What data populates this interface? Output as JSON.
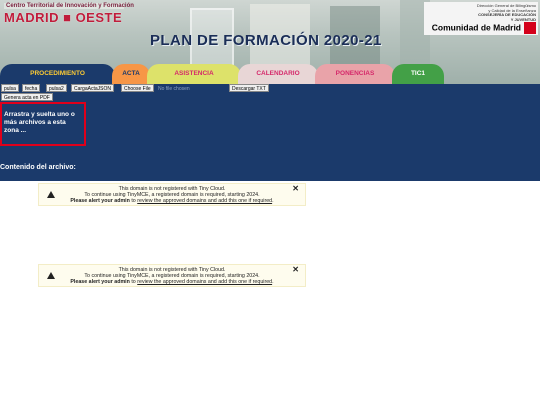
{
  "header": {
    "logo_left_small": "Centro Territorial de Innovación y Formación",
    "logo_left_big": "MADRID ■ OESTE",
    "logo_right_small1": "Dirección General de Bilingüismo",
    "logo_right_small2": "y Calidad de la Enseñanza",
    "logo_right_small3": "CONSEJERÍA DE EDUCACIÓN",
    "logo_right_small4": "Y JUVENTUD",
    "logo_right_big": "Comunidad de Madrid",
    "title": "PLAN DE FORMACIÓN 2020-21"
  },
  "tabs": [
    {
      "label": "PROCEDIMIENTO",
      "color": "#1b3a6b",
      "text": "#ffcc33"
    },
    {
      "label": "ACTA",
      "color": "#f79646",
      "text": "#1b3a6b"
    },
    {
      "label": "ASISTENCIA",
      "color": "#dde26a",
      "text": "#d5296a"
    },
    {
      "label": "CALENDARIO",
      "color": "#e8d6d6",
      "text": "#d5296a"
    },
    {
      "label": "PONENCIAS",
      "color": "#e9a3a9",
      "text": "#d5296a"
    },
    {
      "label": "TIC1",
      "color": "#43a047",
      "text": "#ffffff"
    }
  ],
  "toolbar": {
    "pulsa": "pulsa",
    "fecha": "fecha",
    "pulsa2": "pulsa2",
    "cargar_json": "CargaActaJSON",
    "choose_file": "Choose File",
    "no_file": "No file chosen",
    "descargar_txt": "Descargar TXT",
    "generar_pdf": "Genera acta en PDF"
  },
  "dropzone": {
    "text": "Arrastra y suelta uno o más archivos a esta zona ...",
    "line3": "..."
  },
  "contenido_label": "Contenido del archivo:",
  "alerts": [
    {
      "line1": "This domain is not registered with Tiny Cloud.",
      "line2": "To continue using TinyMCE, a registered domain is required, starting 2024.",
      "bold": "Please alert your admin",
      "to": " to ",
      "link": "review the approved domains and add this one if required",
      "end": ".",
      "close": "✕"
    },
    {
      "line1": "This domain is not registered with Tiny Cloud.",
      "line2": "To continue using TinyMCE, a registered domain is required, starting 2024.",
      "bold": "Please alert your admin",
      "to": " to ",
      "link": "review the approved domains and add this one if required",
      "end": ".",
      "close": "✕"
    }
  ]
}
